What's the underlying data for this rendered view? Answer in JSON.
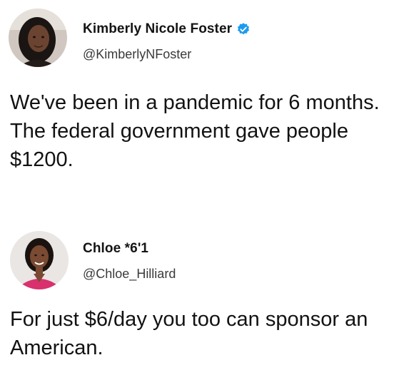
{
  "tweets": [
    {
      "display_name": "Kimberly Nicole Foster",
      "handle": "@KimberlyNFoster",
      "verified": true,
      "text": "We've been in a pandemic for 6 months. The federal government gave people $1200."
    },
    {
      "display_name": "Chloe *6'1",
      "handle": "@Chloe_Hilliard",
      "verified": false,
      "text": "For just $6/day you too can sponsor an American."
    }
  ],
  "colors": {
    "verified_badge": "#1d9bf0",
    "text": "#121212",
    "handle": "#3a3a3a"
  }
}
